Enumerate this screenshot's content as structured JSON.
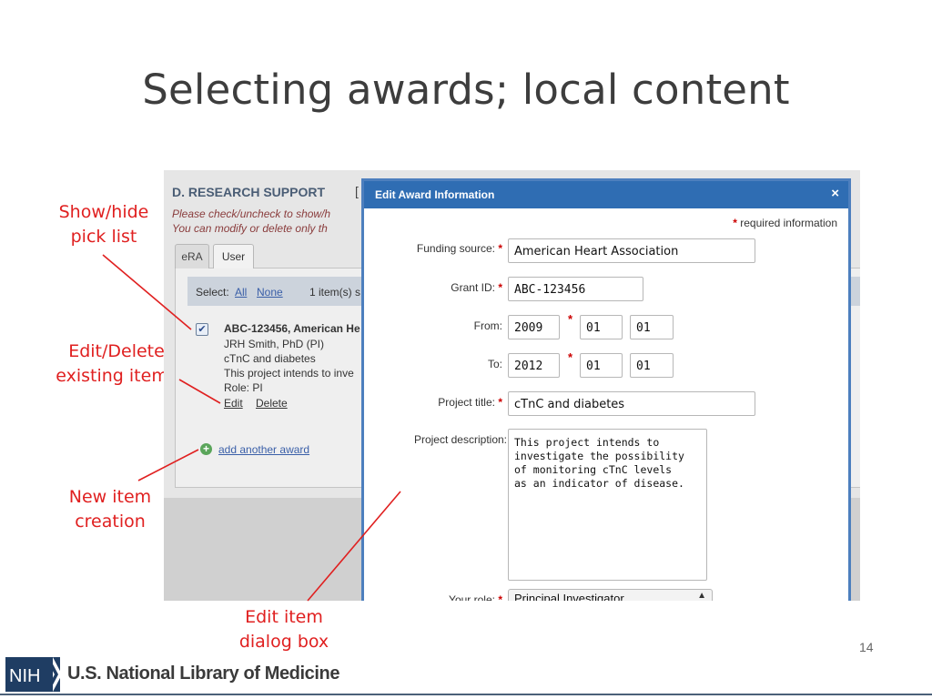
{
  "slide": {
    "title": "Selecting awards; local content",
    "page_number": "14"
  },
  "annotations": {
    "show_hide": [
      "Show/hide",
      "pick list"
    ],
    "edit_delete": [
      "Edit/Delete",
      "existing items"
    ],
    "new_item": [
      "New item",
      "creation"
    ],
    "edit_dialog": [
      "Edit item",
      "dialog box"
    ]
  },
  "footer": {
    "logo_text": "NIH",
    "org_name": "U.S. National Library of Medicine"
  },
  "research_support": {
    "section_title": "D. RESEARCH SUPPORT",
    "bracket": "[",
    "note_line1": "Please check/uncheck to show/h",
    "note_line2": "You can modify or delete only th",
    "tabs": [
      "eRA",
      "User"
    ],
    "select_label": "Select:",
    "select_all": "All",
    "select_none": "None",
    "count_text": "1 item(s) s",
    "item": {
      "title": "ABC-123456, American He",
      "person": "JRH Smith, PhD (PI)",
      "project": "cTnC and diabetes",
      "desc": "This project intends to inve",
      "role": "Role: PI",
      "edit": "Edit",
      "delete": "Delete"
    },
    "add_icon": "plus-circle-icon",
    "add_label": "add another award"
  },
  "dialog": {
    "title": "Edit Award Information",
    "close": "×",
    "required_note": "required information",
    "labels": {
      "funding_source": "Funding source:",
      "grant_id": "Grant ID:",
      "from": "From:",
      "to": "To:",
      "project_title": "Project title:",
      "project_description": "Project description:",
      "your_role": "Your role:"
    },
    "values": {
      "funding_source": "American Heart Association",
      "grant_id": "ABC-123456",
      "from_year": "2009",
      "from_month": "01",
      "from_day": "01",
      "to_year": "2012",
      "to_month": "01",
      "to_day": "01",
      "project_title": "cTnC and diabetes",
      "project_description": [
        "This project intends to",
        "investigate the possibility",
        "of monitoring cTnC levels",
        "as an indicator of disease."
      ],
      "your_role": "Principal Investigator"
    }
  },
  "colors": {
    "annotation": "#e02020",
    "dialog_header": "#2f6db3",
    "required_star": "#cc0000"
  }
}
